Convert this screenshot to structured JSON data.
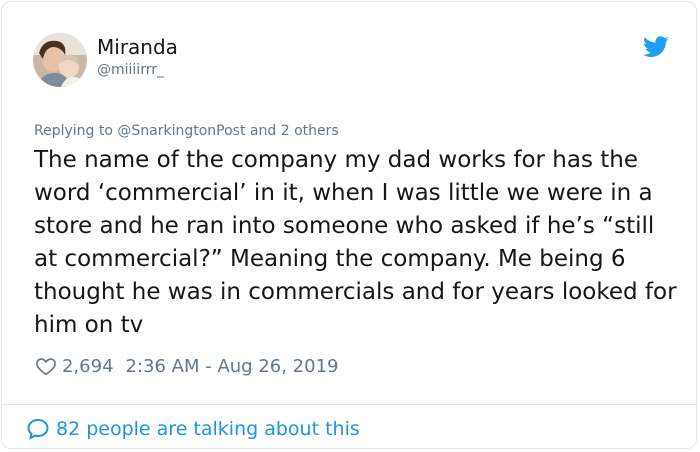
{
  "author": {
    "name": "Miranda",
    "handle": "@miiiirrr_",
    "avatar_icon": "profile-photo"
  },
  "platform_icon": "twitter-bird-icon",
  "reply_context": {
    "prefix": "Replying to",
    "mention": "@SnarkingtonPost",
    "suffix": "and 2 others"
  },
  "tweet_text": "The name of the company my dad works for has the word ‘commercial’ in it, when I was little we were in a store and he ran into someone who asked if he’s “still at commercial?” Meaning the company. Me being 6 thought he was in commercials and for years looked for him on tv",
  "meta": {
    "likes": "2,694",
    "timestamp": "2:36 AM - Aug 26, 2019"
  },
  "footer": {
    "talking_text": "82 people are talking about this"
  },
  "colors": {
    "accent": "#1b95e0",
    "secondary_text": "#657786",
    "primary_text": "#14171a",
    "border": "#e1e8ed"
  }
}
